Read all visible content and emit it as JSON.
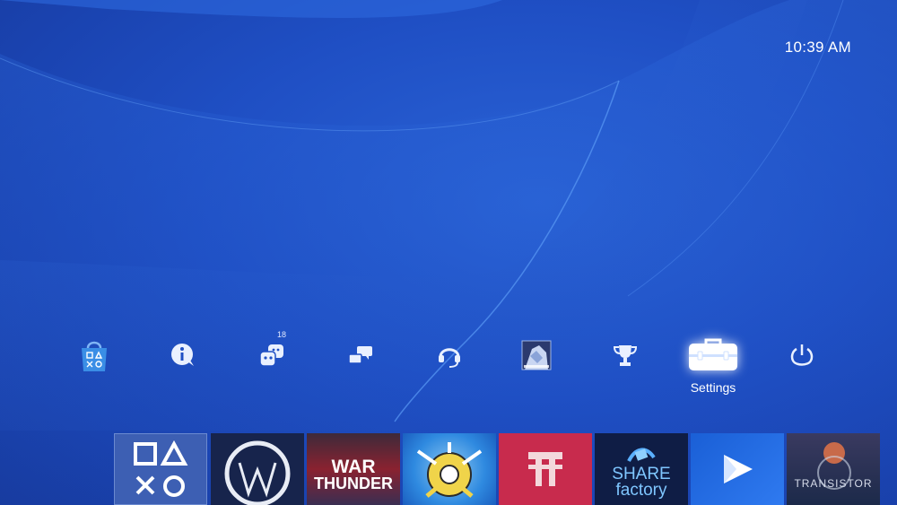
{
  "system": {
    "time": "10:39 AM"
  },
  "function_bar": {
    "items": [
      {
        "id": "playstation-store",
        "label": ""
      },
      {
        "id": "whats-new",
        "label": ""
      },
      {
        "id": "friends",
        "label": "",
        "badge": "18"
      },
      {
        "id": "messages",
        "label": ""
      },
      {
        "id": "party",
        "label": ""
      },
      {
        "id": "profile",
        "label": ""
      },
      {
        "id": "trophies",
        "label": ""
      },
      {
        "id": "settings",
        "label": "Settings",
        "selected": true
      },
      {
        "id": "power",
        "label": ""
      }
    ]
  },
  "content_row": {
    "tiles": [
      {
        "id": "library",
        "text": ""
      },
      {
        "id": "watch-dogs",
        "text": ""
      },
      {
        "id": "war-thunder",
        "text_line1": "WAR",
        "text_line2": "THUNDER"
      },
      {
        "id": "game-4",
        "text": ""
      },
      {
        "id": "wolfenstein",
        "text": ""
      },
      {
        "id": "share-factory",
        "text_line1": "SHARE",
        "text_line2": "factory"
      },
      {
        "id": "playstation-video",
        "text": ""
      },
      {
        "id": "transistor",
        "text": "TRANSISTOR"
      }
    ]
  },
  "colors": {
    "background": "#1f4fc4",
    "selected_glow": "#ffffff",
    "store_bag": "#3a8ee6"
  }
}
